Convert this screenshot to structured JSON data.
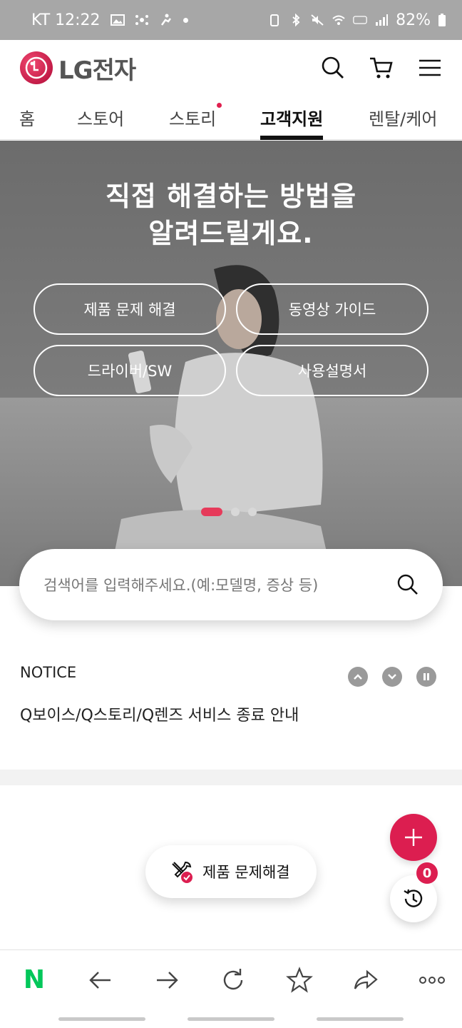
{
  "status_bar": {
    "carrier_time": "KT 12:22",
    "battery": "82%"
  },
  "header": {
    "brand": "LG전자"
  },
  "tabs": [
    {
      "label": "홈"
    },
    {
      "label": "스토어"
    },
    {
      "label": "스토리"
    },
    {
      "label": "고객지원"
    },
    {
      "label": "렌탈/케어"
    }
  ],
  "hero": {
    "title_line1": "직접 해결하는 방법을",
    "title_line2": "알려드릴게요.",
    "buttons": [
      {
        "label": "제품 문제 해결"
      },
      {
        "label": "동영상 가이드"
      },
      {
        "label": "드라이버/SW"
      },
      {
        "label": "사용설명서"
      }
    ],
    "slide_count": 3,
    "active_slide": 1
  },
  "search": {
    "placeholder": "검색어를 입력해주세요.(예:모델명, 증상 등)"
  },
  "notice": {
    "label": "NOTICE",
    "text": "Q보이스/Q스토리/Q렌즈 서비스 종료 안내"
  },
  "floating": {
    "history_count": "0",
    "chip_label": "제품 문제해결"
  },
  "bottom_bar": {
    "naver": "N"
  },
  "colors": {
    "accent": "#dc1e50",
    "naver_green": "#03c75a"
  }
}
